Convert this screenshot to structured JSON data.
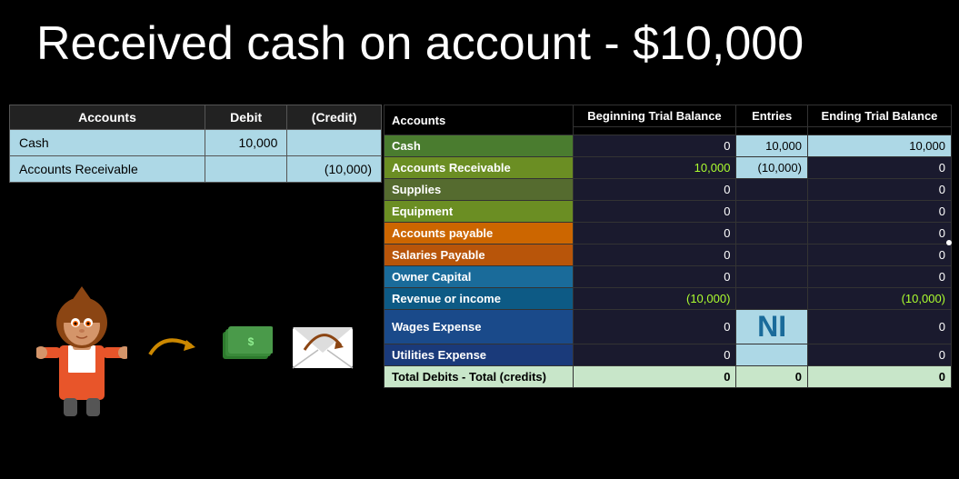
{
  "title": "Received cash on account - $10,000",
  "journal": {
    "headers": [
      "Accounts",
      "Debit",
      "(Credit)"
    ],
    "rows": [
      {
        "account": "Cash",
        "debit": "10,000",
        "credit": ""
      },
      {
        "account": "Accounts Receivable",
        "debit": "",
        "credit": "(10,000)"
      }
    ]
  },
  "trial_balance": {
    "headers": {
      "accounts": "Accounts",
      "beginning": "Beginning Trial Balance",
      "entries": "Entries",
      "ending": "Ending Trial Balance"
    },
    "rows": [
      {
        "account": "Cash",
        "beginning": "0",
        "entries": "10,000",
        "ending": "10,000",
        "rowClass": "row-green",
        "beginClass": "num-cell",
        "entriesClass": "num-cell-light",
        "endingClass": "num-cell-light"
      },
      {
        "account": "Accounts Receivable",
        "beginning": "10,000",
        "entries": "(10,000)",
        "ending": "0",
        "rowClass": "row-olive",
        "beginClass": "num-cell-yellow-green",
        "entriesClass": "num-cell-light",
        "endingClass": "num-cell"
      },
      {
        "account": "Supplies",
        "beginning": "0",
        "entries": "",
        "ending": "0",
        "rowClass": "row-darkolive",
        "beginClass": "num-cell",
        "entriesClass": "num-cell",
        "endingClass": "num-cell"
      },
      {
        "account": "Equipment",
        "beginning": "0",
        "entries": "",
        "ending": "0",
        "rowClass": "row-olive",
        "beginClass": "num-cell",
        "entriesClass": "num-cell",
        "endingClass": "num-cell"
      },
      {
        "account": "Accounts payable",
        "beginning": "0",
        "entries": "",
        "ending": "0",
        "rowClass": "row-orange",
        "beginClass": "num-cell",
        "entriesClass": "num-cell",
        "endingClass": "num-cell"
      },
      {
        "account": "Salaries Payable",
        "beginning": "0",
        "entries": "",
        "ending": "0",
        "rowClass": "row-darkorange",
        "beginClass": "num-cell",
        "entriesClass": "num-cell",
        "endingClass": "num-cell"
      },
      {
        "account": "Owner Capital",
        "beginning": "0",
        "entries": "",
        "ending": "0",
        "rowClass": "row-blue",
        "beginClass": "num-cell",
        "entriesClass": "num-cell",
        "endingClass": "num-cell"
      },
      {
        "account": "Revenue or income",
        "beginning": "(10,000)",
        "entries": "",
        "ending": "(10,000)",
        "rowClass": "row-darkblue",
        "beginClass": "num-cell-yellow-green",
        "entriesClass": "num-cell",
        "endingClass": "num-cell-yellow-green"
      },
      {
        "account": "Wages Expense",
        "beginning": "0",
        "entries": "NI",
        "ending": "0",
        "rowClass": "row-deepblue",
        "beginClass": "num-cell",
        "entriesClass": "ni-cell",
        "endingClass": "num-cell"
      },
      {
        "account": "Utilities Expense",
        "beginning": "0",
        "entries": "",
        "ending": "0",
        "rowClass": "row-navyblue",
        "beginClass": "num-cell",
        "entriesClass": "num-cell-light",
        "endingClass": "num-cell"
      },
      {
        "account": "Total Debits - Total (credits)",
        "beginning": "0",
        "entries": "0",
        "ending": "0",
        "rowClass": "row-totalrow",
        "beginClass": "total-row-cell",
        "entriesClass": "total-row-cell",
        "endingClass": "total-row-cell",
        "isTotal": true
      }
    ]
  }
}
